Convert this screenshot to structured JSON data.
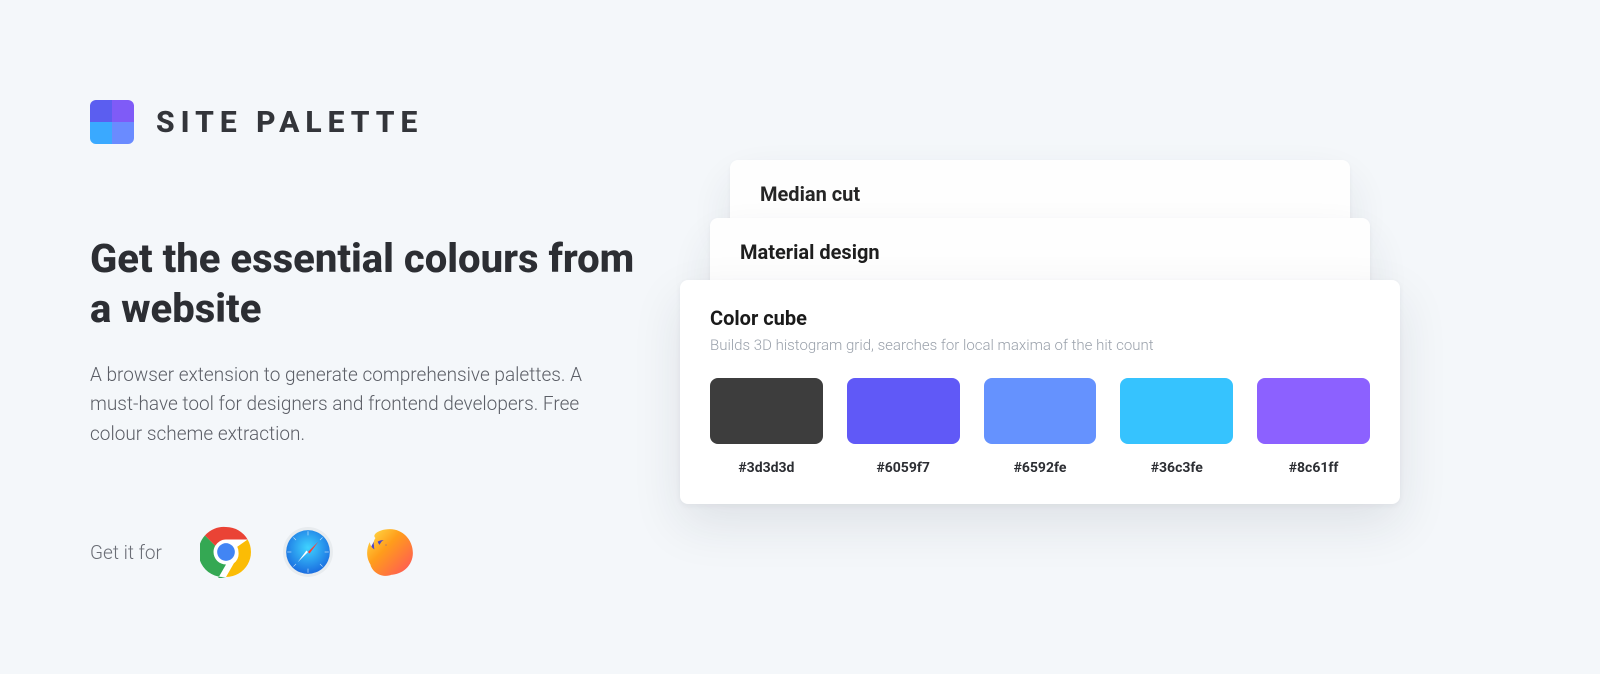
{
  "brand": {
    "name": "SITE PALETTE"
  },
  "hero": {
    "headline": "Get the essential colours from a website",
    "subtext": "A browser extension to generate comprehensive palettes. A must-have tool for designers and frontend developers. Free colour scheme extraction.",
    "get_label": "Get it for"
  },
  "browsers": {
    "chrome": "chrome-icon",
    "safari": "safari-icon",
    "firefox": "firefox-icon"
  },
  "cards": {
    "back1": {
      "title": "Median cut"
    },
    "back2": {
      "title": "Material design"
    },
    "front": {
      "title": "Color cube",
      "desc": "Builds 3D histogram grid, searches for local maxima of the hit count",
      "swatches": [
        {
          "hex": "#3d3d3d"
        },
        {
          "hex": "#6059f7"
        },
        {
          "hex": "#6592fe"
        },
        {
          "hex": "#36c3fe"
        },
        {
          "hex": "#8c61ff"
        }
      ]
    }
  }
}
